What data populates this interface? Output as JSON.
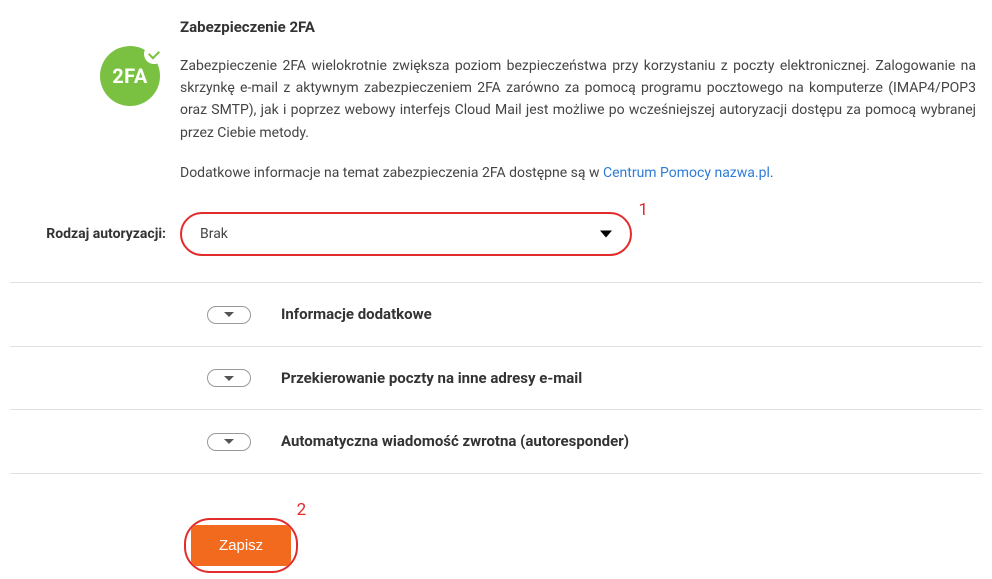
{
  "section": {
    "title": "Zabezpieczenie 2FA",
    "icon_text": "2FA",
    "desc": "Zabezpieczenie 2FA wielokrotnie zwiększa poziom bezpieczeństwa przy korzystaniu z poczty elektronicznej. Zalogowanie na skrzynkę e-mail z aktywnym zabezpieczeniem 2FA zarówno za pomocą programu pocztowego na komputerze (IMAP4/POP3 oraz SMTP), jak i poprzez webowy interfejs Cloud Mail jest możliwe po wcześniejszej autoryzacji dostępu za pomocą wybranej przez Ciebie metody.",
    "more_prefix": "Dodatkowe informacje na temat zabezpieczenia 2FA dostępne są w ",
    "more_link_text": "Centrum Pomocy nazwa.pl",
    "more_suffix": "."
  },
  "form": {
    "auth_label": "Rodzaj autoryzacji:",
    "auth_value": "Brak"
  },
  "annotations": {
    "one": "1",
    "two": "2"
  },
  "accordion": {
    "item1": "Informacje dodatkowe",
    "item2": "Przekierowanie poczty na inne adresy e-mail",
    "item3": "Automatyczna wiadomość zwrotna (autoresponder)"
  },
  "buttons": {
    "save": "Zapisz"
  }
}
